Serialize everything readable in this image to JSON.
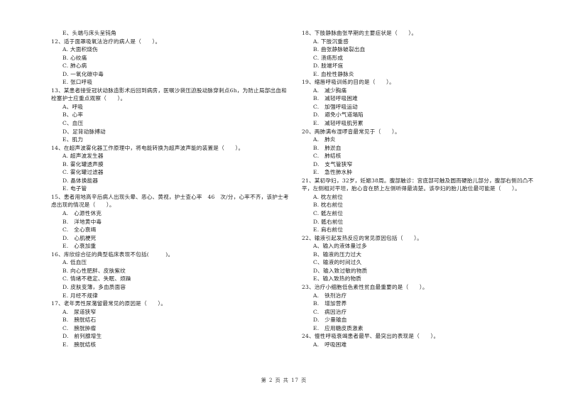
{
  "left_column": {
    "lead_option": "E、头端与床头呈钝角",
    "questions": [
      {
        "stem": "12、适于面罩吸氧法治疗的病人是（　　）。",
        "options": [
          "A. 大面积烧伤",
          "B. 心绞痛",
          "C. 肺心病",
          "D. 一氧化碳中毒",
          "E. 张口呼吸"
        ]
      },
      {
        "stem": "13、某患者接受冠状动脉造影术后回到病房，医嘱沙袋压迫股动脉穿刺点6h，为防止局部出血和栓塞护士应重点观察（　　）。",
        "options": [
          "A、呼吸",
          "B、心率",
          "C、血压",
          "D、足背动脉搏动",
          "E、肌力"
        ]
      },
      {
        "stem": "14、在超声波雾化器工作原理中，将电能转换为超声波声能的装置是（　　）。",
        "options": [
          "A. 超声波发生器",
          "B. 雾化罐透声膜",
          "C. 雾化罐过滤器",
          "D. 晶体换能器",
          "E. 电子管"
        ]
      },
      {
        "stem": "15、患者用地高辛后病人出现头晕、恶心、黄视，护士查心率　46　次/分，心率不齐，该护士考虑出现的情况是（　　）。",
        "options": [
          "A.　心源性休克",
          "B.　洋地黄中毒",
          "C.　全心衰竭",
          "D.　心肌梗死",
          "E.　心衰加重"
        ]
      },
      {
        "stem": "16、库欣综合征的典型临床表现不包括(　　　)。",
        "options": [
          "A. 低血压",
          "B. 向心性肥胖、皮肤紫纹",
          "C. 情绪不稳定、失眠、烦躁",
          "D. 皮肤变薄，多血质面容",
          "E. 月经不规律"
        ]
      },
      {
        "stem": "17、老年男性尿潴留最常见的原因是（　　）。",
        "options": [
          "A.　尿道狭窄",
          "B.　膀胱结石",
          "C.　膀胱肿瘤",
          "D.　前列腺增生",
          "E.　膀胱结核"
        ]
      }
    ]
  },
  "right_column": {
    "questions": [
      {
        "stem": "18、下肢静脉曲张早期的主要症状是（　　）。",
        "options": [
          "A. 下肢沉重感",
          "B. 曲张静脉破裂出血",
          "C. 溃疡形成",
          "D. 肢端坏疽",
          "E. 血栓性静脉炎"
        ]
      },
      {
        "stem": "19、缩唇呼吸训练的目的是（　　）。",
        "options": [
          "A.　减少胸痛",
          "B.　减轻呼吸困难",
          "C.　加强呼吸运动",
          "D.　避免小气道塌陷",
          "E.　减轻呼吸肌劳累"
        ]
      },
      {
        "stem": "20、两肺满布湿啰音最常见于（　　）。",
        "options": [
          "A.　肺炎",
          "B.　肺淤血",
          "C.　肺结核",
          "D.　支气管狭窄",
          "E.　急性肺水肿"
        ]
      },
      {
        "stem": "21、某初孕妇，32岁，妊娠38周。腹部触诊：宫底部可触及圆而硬胎儿部分，腹部右侧凹凸不平，左侧相对平坦，胎心音在脐上左侧听得最清楚。该孕妇的胎儿胎位最可能是（　　）。",
        "options": [
          "A. 枕左前位",
          "B. 枕右前位",
          "C. 骶左前位",
          "D. 骶右前位",
          "E. 肩右前位"
        ]
      },
      {
        "stem": "22、输液引起发热反应的常见原因包括（　　）。",
        "options": [
          "A、输入的液体量过多",
          "B、输液的压力过大",
          "C、输液的时间过久",
          "D、输入致过敏的物质",
          "E、输入致热的物质"
        ]
      },
      {
        "stem": "23、治疗小细胞低色素性贫血最重要的是（　　）。",
        "options": [
          "A.　铁剂治疗",
          "B.　增加营养",
          "C.　病因治疗",
          "D.　少量输血",
          "E.　应用糖皮质激素"
        ]
      },
      {
        "stem": "24、慢性呼吸衰竭患者最早、最突出的表现是（　　）。",
        "options": [
          "A.　呼吸困难"
        ]
      }
    ]
  },
  "footer": {
    "page_label": "第 2 页 共 17 页"
  }
}
